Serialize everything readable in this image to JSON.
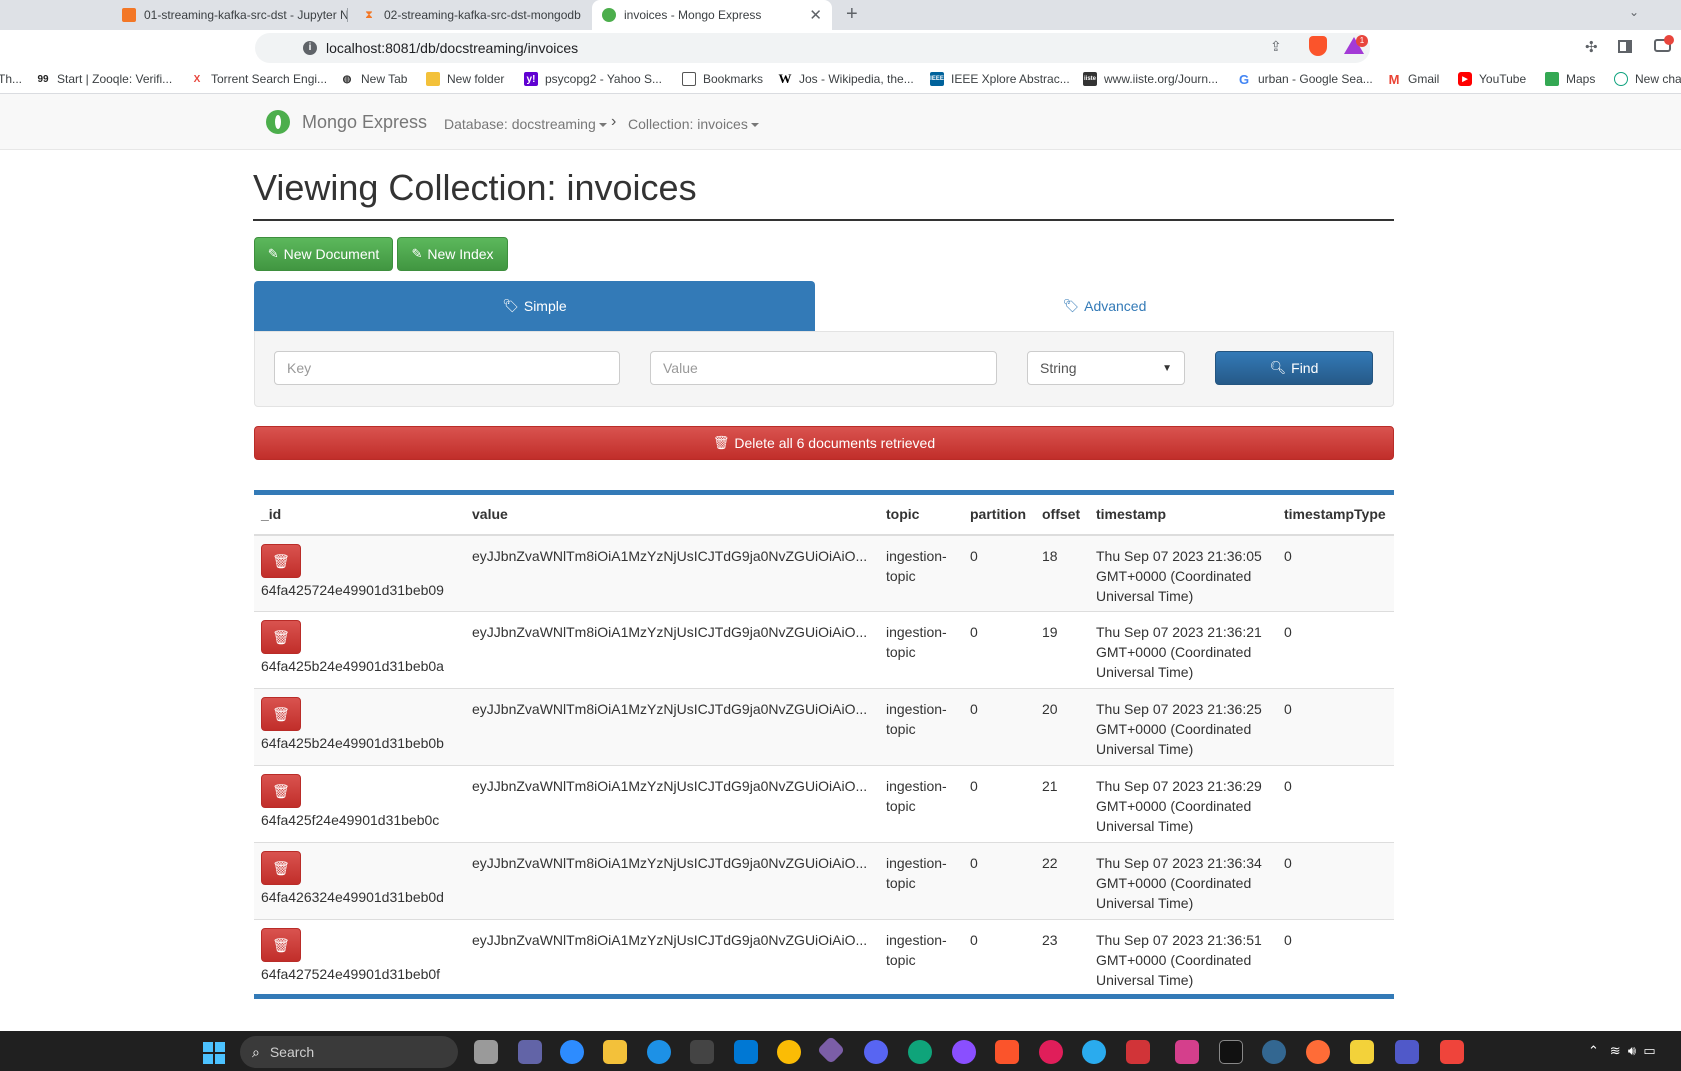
{
  "browser": {
    "tabs": [
      {
        "title": "01-streaming-kafka-src-dst - Jupyter N",
        "icon": "jupyter-icon"
      },
      {
        "title": "02-streaming-kafka-src-dst-mongodb",
        "icon": "hourglass-icon"
      },
      {
        "title": "invoices - Mongo Express",
        "icon": "mongo-leaf-icon",
        "active": true
      }
    ],
    "url": "localhost:8081/db/docstreaming/invoices",
    "rewards_badge": "1",
    "bookmarks": [
      {
        "label": "Th...",
        "icon": "page-icon"
      },
      {
        "label": "Start | Zooqle: Verifi...",
        "icon": "zooqle-icon"
      },
      {
        "label": "Torrent Search Engi...",
        "icon": "x-icon"
      },
      {
        "label": "New Tab",
        "icon": "globe-icon"
      },
      {
        "label": "New folder",
        "icon": "folder-icon"
      },
      {
        "label": "psycopg2 - Yahoo S...",
        "icon": "yahoo-icon"
      },
      {
        "label": "Bookmarks",
        "icon": "page-icon"
      },
      {
        "label": "Jos - Wikipedia, the...",
        "icon": "wikipedia-icon"
      },
      {
        "label": "IEEE Xplore Abstrac...",
        "icon": "ieee-icon"
      },
      {
        "label": "www.iiste.org/Journ...",
        "icon": "iiste-icon"
      },
      {
        "label": "urban - Google Sea...",
        "icon": "google-icon"
      },
      {
        "label": "Gmail",
        "icon": "gmail-icon"
      },
      {
        "label": "YouTube",
        "icon": "youtube-icon"
      },
      {
        "label": "Maps",
        "icon": "maps-icon"
      },
      {
        "label": "New cha",
        "icon": "chatgpt-icon"
      }
    ]
  },
  "navbar": {
    "brand": "Mongo Express",
    "database": "Database: docstreaming",
    "collection": "Collection: invoices"
  },
  "page": {
    "title": "Viewing Collection: invoices",
    "new_document": "New Document",
    "new_index": "New Index",
    "tab_simple": "Simple",
    "tab_advanced": "Advanced",
    "key_placeholder": "Key",
    "value_placeholder": "Value",
    "type_selected": "String",
    "find": "Find",
    "delete_all": "Delete all 6 documents retrieved"
  },
  "table": {
    "columns": [
      "_id",
      "value",
      "topic",
      "partition",
      "offset",
      "timestamp",
      "timestampType"
    ],
    "rows": [
      {
        "_id": "64fa425724e49901d31beb09",
        "value": "eyJJbnZvaWNlTm8iOiA1MzYzNjUsICJTdG9ja0NvZGUiOiAiO...",
        "topic": "ingestion-topic",
        "partition": "0",
        "offset": "18",
        "timestamp": "Thu Sep 07 2023 21:36:05 GMT+0000 (Coordinated Universal Time)",
        "timestampType": "0"
      },
      {
        "_id": "64fa425b24e49901d31beb0a",
        "value": "eyJJbnZvaWNlTm8iOiA1MzYzNjUsICJTdG9ja0NvZGUiOiAiO...",
        "topic": "ingestion-topic",
        "partition": "0",
        "offset": "19",
        "timestamp": "Thu Sep 07 2023 21:36:21 GMT+0000 (Coordinated Universal Time)",
        "timestampType": "0"
      },
      {
        "_id": "64fa425b24e49901d31beb0b",
        "value": "eyJJbnZvaWNlTm8iOiA1MzYzNjUsICJTdG9ja0NvZGUiOiAiO...",
        "topic": "ingestion-topic",
        "partition": "0",
        "offset": "20",
        "timestamp": "Thu Sep 07 2023 21:36:25 GMT+0000 (Coordinated Universal Time)",
        "timestampType": "0"
      },
      {
        "_id": "64fa425f24e49901d31beb0c",
        "value": "eyJJbnZvaWNlTm8iOiA1MzYzNjUsICJTdG9ja0NvZGUiOiAiO...",
        "topic": "ingestion-topic",
        "partition": "0",
        "offset": "21",
        "timestamp": "Thu Sep 07 2023 21:36:29 GMT+0000 (Coordinated Universal Time)",
        "timestampType": "0"
      },
      {
        "_id": "64fa426324e49901d31beb0d",
        "value": "eyJJbnZvaWNlTm8iOiA1MzYzNjUsICJTdG9ja0NvZGUiOiAiO...",
        "topic": "ingestion-topic",
        "partition": "0",
        "offset": "22",
        "timestamp": "Thu Sep 07 2023 21:36:34 GMT+0000 (Coordinated Universal Time)",
        "timestampType": "0"
      },
      {
        "_id": "64fa427524e49901d31beb0f",
        "value": "eyJJbnZvaWNlTm8iOiA1MzYzNjUsICJTdG9ja0NvZGUiOiAiO...",
        "topic": "ingestion-topic",
        "partition": "0",
        "offset": "23",
        "timestamp": "Thu Sep 07 2023 21:36:51 GMT+0000 (Coordinated Universal Time)",
        "timestampType": "0"
      }
    ]
  },
  "taskbar": {
    "search": "Search",
    "apps": [
      "file-explorer-icon",
      "teams-icon",
      "zoom-icon",
      "folder-icon",
      "docker-icon",
      "terminal-icon",
      "vscode-icon",
      "chrome-icon",
      "git-icon",
      "discord-icon",
      "edge-icon",
      "github-icon",
      "brave-icon",
      "slack-icon",
      "telegram-icon",
      "notepad-icon",
      "app-icon",
      "cmd-icon",
      "postgres-icon",
      "postman-icon",
      "sticky-icon",
      "teams-icon",
      "anydesk-icon"
    ]
  },
  "colors": {
    "primary": "#337ab7",
    "success": "#5cb85c",
    "danger": "#d9534f"
  }
}
